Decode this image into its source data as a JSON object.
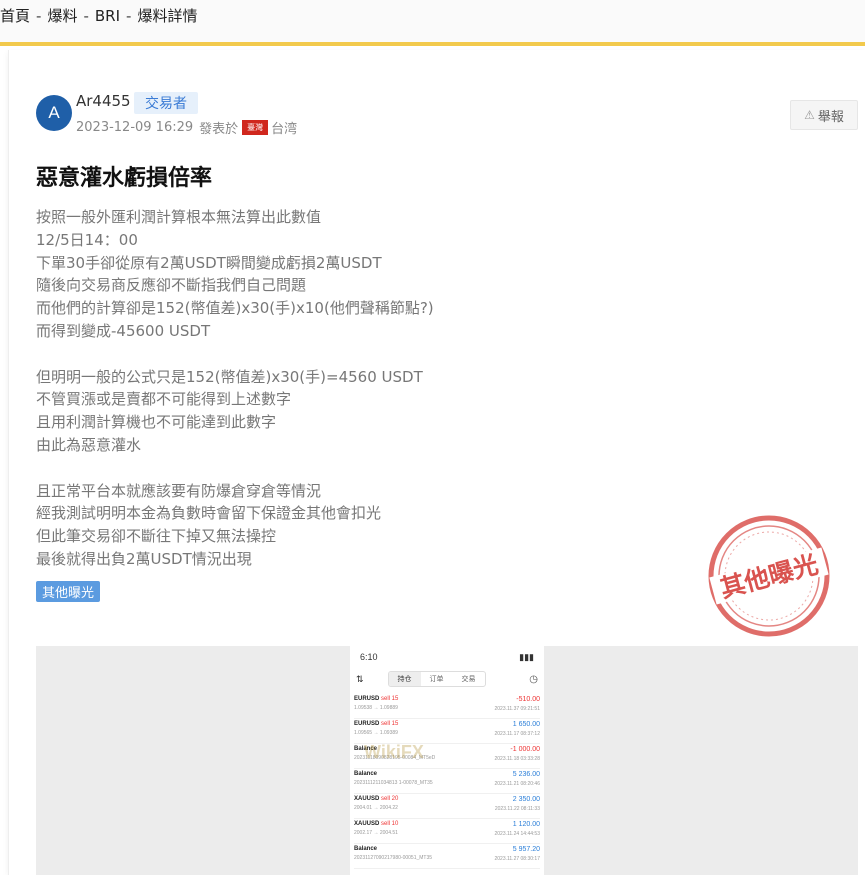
{
  "breadcrumb": {
    "home": "首頁",
    "section": "爆料",
    "broker": "BRI",
    "page": "爆料詳情",
    "separator": "-"
  },
  "post": {
    "avatar_letter": "A",
    "username": "Ar4455",
    "role": "交易者",
    "datetime": "2023-12-09 16:29",
    "posted_from_label": "發表於",
    "flag_label": "臺灣",
    "region": "台湾",
    "report_label": "舉報",
    "title": "惡意灌水虧損倍率",
    "content_lines": [
      "按照一般外匯利潤計算根本無法算出此數值",
      "12/5日14：00",
      "下單30手卻從原有2萬USDT瞬間變成虧損2萬USDT",
      "隨後向交易商反應卻不斷指我們自己問題",
      "而他們的計算卻是152(幣值差)x30(手)x10(他們聲稱節點?)",
      "而得到變成-45600 USDT",
      "",
      "但明明一般的公式只是152(幣值差)x30(手)=4560 USDT",
      "不管買漲或是賣都不可能得到上述數字",
      "且用利潤計算機也不可能達到此數字",
      "由此為惡意灌水",
      "",
      "且正常平台本就應該要有防爆倉穿倉等情況",
      "經我測試明明本金為負數時會留下保證金其他會扣光",
      "但此筆交易卻不斷往下掉又無法操控",
      "最後就得出負2萬USDT情況出現"
    ],
    "tag": "其他曝光",
    "stamp_text": "其他曝光"
  },
  "screenshot": {
    "time": "6:10",
    "signal": "▮▮▮",
    "tabs": [
      "持仓",
      "订单",
      "交易"
    ],
    "watermark": "WikiFX",
    "rows": [
      {
        "symbol": "EURUSD",
        "side": "sell 15",
        "sub": "1.09538 → 1.09889",
        "amount": "-510.00",
        "sign": "neg",
        "date": "2023.11.37 09:21:51"
      },
      {
        "symbol": "EURUSD",
        "side": "sell 15",
        "sub": "1.09565 → 1.09389",
        "amount": "1 650.00",
        "sign": "pos",
        "date": "2023.11.17 08:37:12"
      },
      {
        "symbol": "Balance",
        "side": "",
        "sub": "20231118090828195-00084_MT5eD",
        "amount": "-1 000.00",
        "sign": "neg",
        "date": "2023.11.18 03:33:28"
      },
      {
        "symbol": "Balance",
        "side": "",
        "sub": "2023111211034813 1-00078_MT35",
        "amount": "5 236.00",
        "sign": "pos",
        "date": "2023.11.21 08:20:46"
      },
      {
        "symbol": "XAUUSD",
        "side": "sell 20",
        "sub": "2004.01 → 2004.22",
        "amount": "2 350.00",
        "sign": "pos",
        "date": "2023.11.22 08:11:33"
      },
      {
        "symbol": "XAUUSD",
        "side": "sell 10",
        "sub": "2002.17 → 2004.51",
        "amount": "1 120.00",
        "sign": "pos",
        "date": "2023.11.24 14:44:53"
      },
      {
        "symbol": "Balance",
        "side": "",
        "sub": "20231127090217980-00051_MT35",
        "amount": "5 957.20",
        "sign": "pos",
        "date": "2023.11.27 08:30:17"
      }
    ]
  }
}
